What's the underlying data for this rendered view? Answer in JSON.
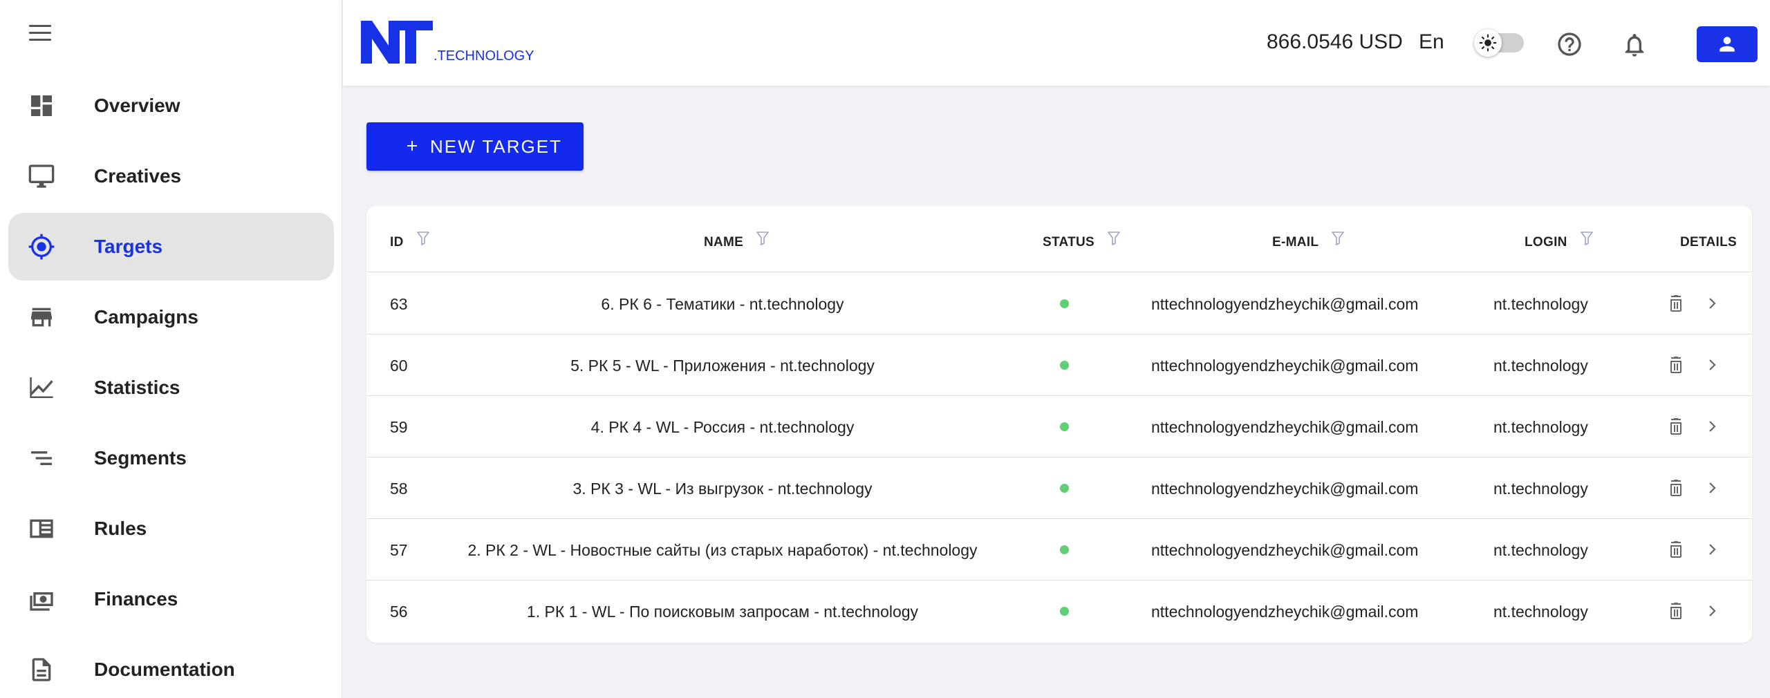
{
  "brand": {
    "logo_main": "NT",
    "logo_sub": ".TECHNOLOGY"
  },
  "header": {
    "balance": "866.0546 USD",
    "language": "En"
  },
  "sidebar": {
    "items": [
      {
        "label": "Overview",
        "icon": "dashboard-icon"
      },
      {
        "label": "Creatives",
        "icon": "monitor-icon"
      },
      {
        "label": "Targets",
        "icon": "crosshair-icon",
        "active": true
      },
      {
        "label": "Campaigns",
        "icon": "store-icon"
      },
      {
        "label": "Statistics",
        "icon": "line-chart-icon"
      },
      {
        "label": "Segments",
        "icon": "segments-icon"
      },
      {
        "label": "Rules",
        "icon": "rules-icon"
      },
      {
        "label": "Finances",
        "icon": "money-icon"
      },
      {
        "label": "Documentation",
        "icon": "document-icon"
      }
    ]
  },
  "actions": {
    "new_target": "NEW TARGET"
  },
  "table": {
    "columns": {
      "id": "ID",
      "name": "NAME",
      "status": "STATUS",
      "email": "E-MAIL",
      "login": "LOGIN",
      "details": "DETAILS"
    },
    "rows": [
      {
        "id": "63",
        "name": "6. РК 6 - Тематики - nt.technology",
        "status": "active",
        "email": "nttechnologyendzheychik@gmail.com",
        "login": "nt.technology"
      },
      {
        "id": "60",
        "name": "5. РК 5 - WL - Приложения - nt.technology",
        "status": "active",
        "email": "nttechnologyendzheychik@gmail.com",
        "login": "nt.technology"
      },
      {
        "id": "59",
        "name": "4. РК 4 - WL - Россия - nt.technology",
        "status": "active",
        "email": "nttechnologyendzheychik@gmail.com",
        "login": "nt.technology"
      },
      {
        "id": "58",
        "name": "3. РК 3 - WL - Из выгрузок - nt.technology",
        "status": "active",
        "email": "nttechnologyendzheychik@gmail.com",
        "login": "nt.technology"
      },
      {
        "id": "57",
        "name": "2. РК 2 - WL - Новостные сайты (из старых наработок) - nt.technology",
        "status": "active",
        "email": "nttechnologyendzheychik@gmail.com",
        "login": "nt.technology"
      },
      {
        "id": "56",
        "name": "1. РК 1 - WL - По поисковым запросам - nt.technology",
        "status": "active",
        "email": "nttechnologyendzheychik@gmail.com",
        "login": "nt.technology"
      }
    ]
  },
  "colors": {
    "accent": "#1329ee",
    "status_active": "#5fcf74",
    "active_nav_bg": "#e4e4e4"
  }
}
